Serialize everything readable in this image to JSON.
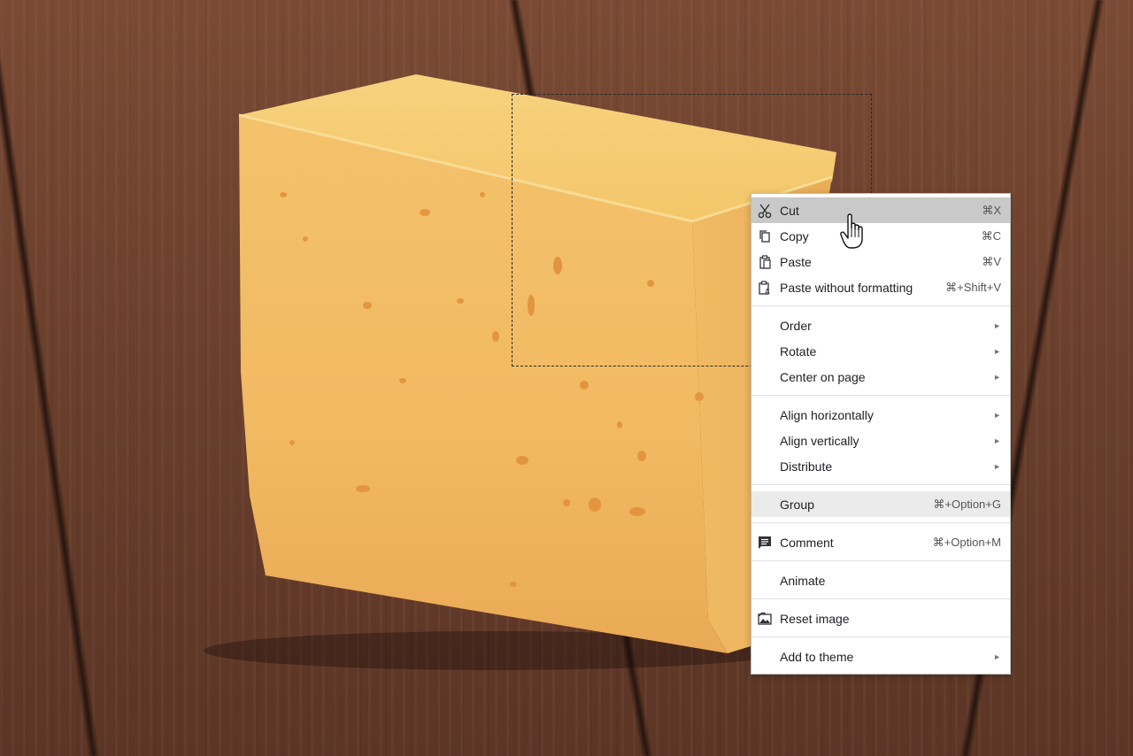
{
  "context_menu": {
    "items": [
      {
        "label": "Cut",
        "shortcut": "⌘X",
        "icon": "scissors-icon"
      },
      {
        "label": "Copy",
        "shortcut": "⌘C",
        "icon": "copy-icon"
      },
      {
        "label": "Paste",
        "shortcut": "⌘V",
        "icon": "paste-icon"
      },
      {
        "label": "Paste without formatting",
        "shortcut": "⌘+Shift+V",
        "icon": "paste-plain-icon"
      },
      {
        "label": "Order",
        "submenu": "►"
      },
      {
        "label": "Rotate",
        "submenu": "►"
      },
      {
        "label": "Center on page",
        "submenu": "►"
      },
      {
        "label": "Align horizontally",
        "submenu": "►"
      },
      {
        "label": "Align vertically",
        "submenu": "►"
      },
      {
        "label": "Distribute",
        "submenu": "►"
      },
      {
        "label": "Group",
        "shortcut": "⌘+Option+G"
      },
      {
        "label": "Comment",
        "shortcut": "⌘+Option+M",
        "icon": "comment-icon"
      },
      {
        "label": "Animate"
      },
      {
        "label": "Reset image",
        "icon": "reset-image-icon"
      },
      {
        "label": "Add to theme",
        "submenu": "►"
      }
    ]
  },
  "colors": {
    "active_item": "#c9c9c9",
    "hover_item": "#ebebeb",
    "cheese": "#f2bc63",
    "wood": "#6a3f2c"
  },
  "cursor": "hand-pointer-icon"
}
